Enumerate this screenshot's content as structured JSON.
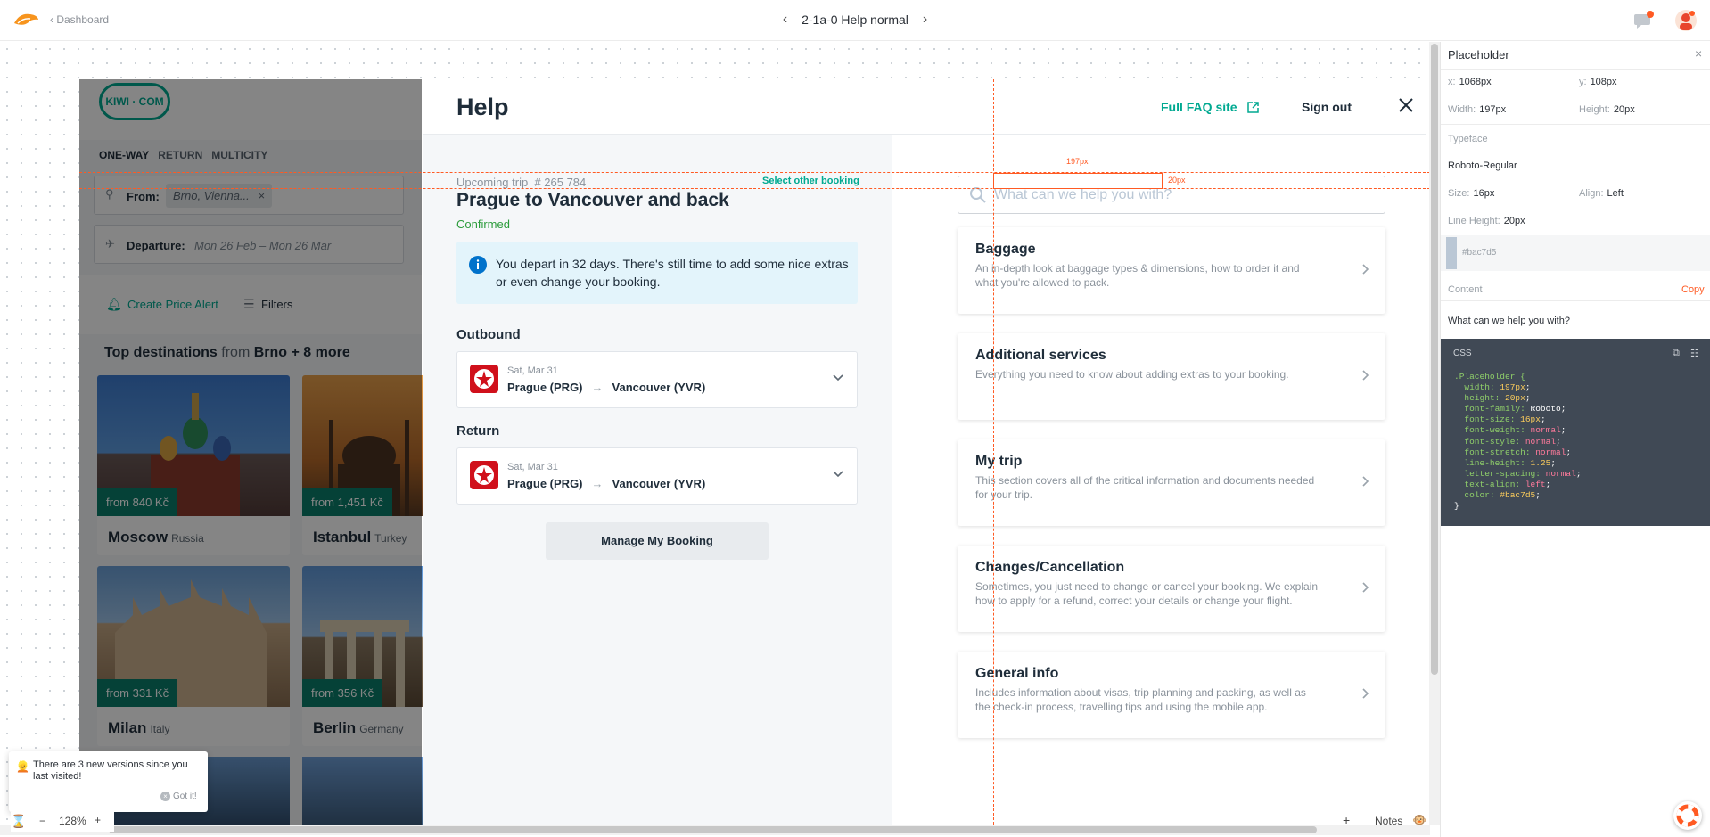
{
  "topbar": {
    "back_label": "Dashboard",
    "screen_title": "2-1a-0 Help normal",
    "prev_arrow": "‹",
    "next_arrow": "›"
  },
  "kiwi": {
    "logo_text": "KIWI · COM",
    "trip_types": [
      "ONE-WAY",
      "RETURN",
      "MULTICITY"
    ],
    "from_label": "From:",
    "from_value": "Brno, Vienna...",
    "departure_label": "Departure:",
    "departure_value": "Mon 26 Feb – Mon 26 Mar",
    "price_alert": "Create Price Alert",
    "filters": "Filters",
    "top_dest_prefix": "Top destinations",
    "top_dest_mid": "from",
    "top_dest_suffix": "Brno + 8 more",
    "destinations": [
      {
        "city": "Moscow",
        "country": "Russia",
        "price": "from 840 Kč"
      },
      {
        "city": "Istanbul",
        "country": "Turkey",
        "price": "from 1,451 Kč"
      },
      {
        "city": "Milan",
        "country": "Italy",
        "price": "from 331 Kč"
      },
      {
        "city": "Berlin",
        "country": "Germany",
        "price": "from 356 Kč"
      }
    ]
  },
  "help": {
    "title": "Help",
    "faq_link": "Full FAQ site",
    "sign_out": "Sign out",
    "upcoming_trip": "Upcoming trip",
    "trip_number": "# 265 784",
    "select_other": "Select other booking",
    "trip_title": "Prague to Vancouver and back",
    "status": "Confirmed",
    "info": "You depart in 32 days. There's still time to add some nice extras or even change your booking.",
    "outbound_label": "Outbound",
    "return_label": "Return",
    "outbound": {
      "date": "Sat, Mar 31",
      "from": "Prague (PRG)",
      "to": "Vancouver (YVR)",
      "arrow": "→"
    },
    "return": {
      "date": "Sat, Mar 31",
      "from": "Prague (PRG)",
      "to": "Vancouver (YVR)",
      "arrow": "→"
    },
    "manage_button": "Manage My Booking",
    "search_placeholder": "What can we help you with?",
    "categories": [
      {
        "title": "Baggage",
        "desc": "An in-depth look at baggage types & dimensions, how to order it and what you're allowed to pack."
      },
      {
        "title": "Additional services",
        "desc": "Everything you need to know about adding extras to your booking."
      },
      {
        "title": "My trip",
        "desc": "This section covers all of the critical information and documents needed for your trip."
      },
      {
        "title": "Changes/Cancellation",
        "desc": "Sometimes, you just need to change or cancel your booking. We explain how to apply for a refund, correct your details or change your flight."
      },
      {
        "title": "General info",
        "desc": "Includes information about visas, trip planning and packing, as well as the check-in process, travelling tips and using the mobile app."
      }
    ]
  },
  "measure": {
    "width_label": "197px",
    "height_label": "20px"
  },
  "inspector": {
    "title": "Placeholder",
    "close": "×",
    "x_label": "x:",
    "x_value": "1068px",
    "y_label": "y:",
    "y_value": "108px",
    "width_label": "Width:",
    "width_value": "197px",
    "height_label": "Height:",
    "height_value": "20px",
    "typeface_label": "Typeface",
    "typeface": "Roboto-Regular",
    "size_label": "Size:",
    "size_value": "16px",
    "align_label": "Align:",
    "align_value": "Left",
    "lineheight_label": "Line Height:",
    "lineheight_value": "20px",
    "color_hex": "#bac7d5",
    "content_label": "Content",
    "copy": "Copy",
    "content_value": "What can we help you with?",
    "css_label": "CSS",
    "css_lines": [
      [
        ".Placeholder {",
        "",
        ""
      ],
      [
        "  width: ",
        "197px",
        ";"
      ],
      [
        "  height: ",
        "20px",
        ";"
      ],
      [
        "  font-family: ",
        "Roboto",
        ";"
      ],
      [
        "  font-size: ",
        "16px",
        ";"
      ],
      [
        "  font-weight: ",
        "normal",
        ";"
      ],
      [
        "  font-style: ",
        "normal",
        ";"
      ],
      [
        "  font-stretch: ",
        "normal",
        ";"
      ],
      [
        "  line-height: ",
        "1.25",
        ";"
      ],
      [
        "  letter-spacing: ",
        "normal",
        ";"
      ],
      [
        "  text-align: ",
        "left",
        ";"
      ],
      [
        "  color: ",
        "#bac7d5",
        ";"
      ],
      [
        "}",
        "",
        ""
      ]
    ]
  },
  "toast": {
    "text": "There are 3 new versions since you last visited!",
    "button": "Got it!"
  },
  "zoom": {
    "minus": "−",
    "value": "128%",
    "plus": "+"
  },
  "notes": {
    "add": "+",
    "label": "Notes"
  },
  "colors": {
    "brand": "#00a991",
    "accent": "#ff5a23",
    "placeholder": "#bac7d5",
    "airline": "#d0101b"
  }
}
